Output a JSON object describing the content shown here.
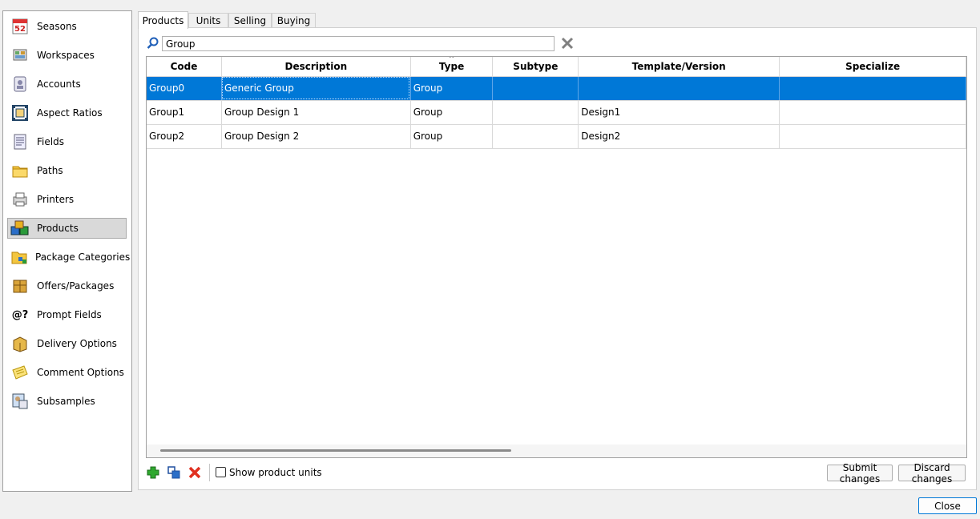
{
  "sidebar": {
    "items": [
      {
        "label": "Seasons",
        "icon": "calendar-icon"
      },
      {
        "label": "Workspaces",
        "icon": "workspace-icon"
      },
      {
        "label": "Accounts",
        "icon": "accounts-icon"
      },
      {
        "label": "Aspect Ratios",
        "icon": "aspect-ratio-icon"
      },
      {
        "label": "Fields",
        "icon": "fields-icon"
      },
      {
        "label": "Paths",
        "icon": "folder-icon"
      },
      {
        "label": "Printers",
        "icon": "printer-icon"
      },
      {
        "label": "Products",
        "icon": "cubes-icon",
        "selected": true
      },
      {
        "label": "Package Categories",
        "icon": "package-categories-icon"
      },
      {
        "label": "Offers/Packages",
        "icon": "box-icon"
      },
      {
        "label": "Prompt Fields",
        "icon": "prompt-icon"
      },
      {
        "label": "Delivery Options",
        "icon": "delivery-box-icon"
      },
      {
        "label": "Comment Options",
        "icon": "notes-icon"
      },
      {
        "label": "Subsamples",
        "icon": "subsample-icon"
      }
    ],
    "calendar_day": "52",
    "prompt_glyph": "@?"
  },
  "tabs": [
    {
      "label": "Products",
      "active": true
    },
    {
      "label": "Units"
    },
    {
      "label": "Selling"
    },
    {
      "label": "Buying"
    }
  ],
  "search": {
    "value": "Group"
  },
  "grid": {
    "columns": [
      "Code",
      "Description",
      "Type",
      "Subtype",
      "Template/Version",
      "Specialize"
    ],
    "sort_indicator": "^",
    "rows": [
      {
        "cells": [
          "Group0",
          "Generic Group",
          "Group",
          "",
          "",
          ""
        ],
        "selected": true
      },
      {
        "cells": [
          "Group1",
          "Group Design 1",
          "Group",
          "",
          "Design1",
          ""
        ]
      },
      {
        "cells": [
          "Group2",
          "Group Design 2",
          "Group",
          "",
          "Design2",
          ""
        ]
      }
    ]
  },
  "toolbar": {
    "show_units_label": "Show product units",
    "show_units_checked": false,
    "submit_label": "Submit changes",
    "discard_label": "Discard changes"
  },
  "close_label": "Close",
  "colors": {
    "selection": "#0078d7",
    "add": "#2ea82e",
    "delete": "#e03020"
  }
}
